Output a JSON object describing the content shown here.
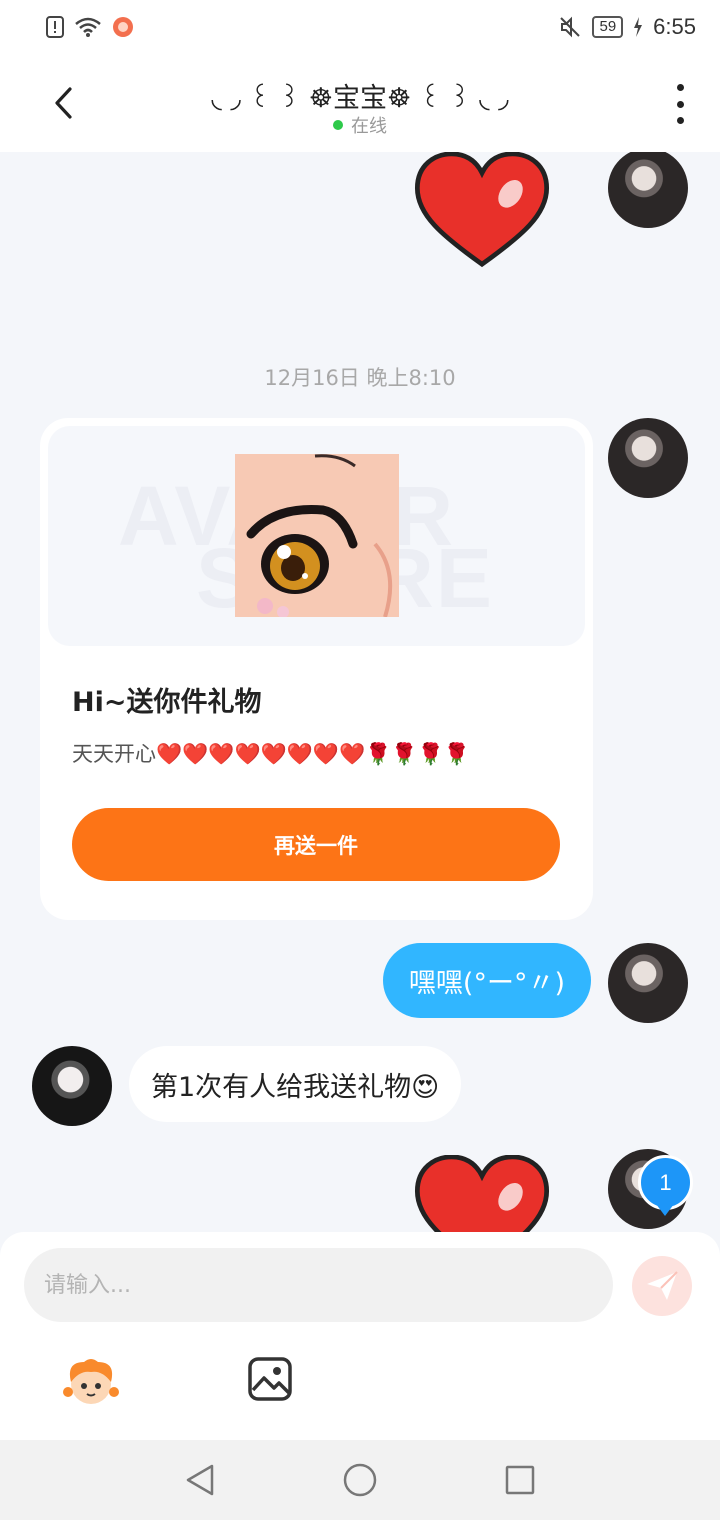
{
  "status_bar": {
    "time": "6:55",
    "battery": "59"
  },
  "header": {
    "title": "◟ ◞ ꒰ ꒱ ☸宝宝☸ ꒰ ꒱ ◟ ◞",
    "online_status": "在线"
  },
  "chat": {
    "timestamp": "12月16日 晚上8:10",
    "gift_card": {
      "watermark_top": "AVATAR",
      "watermark_bottom": "STORE",
      "title": "Hi~送你件礼物",
      "description": "天天开心❤️❤️❤️❤️❤️❤️❤️❤️🌹🌹🌹🌹",
      "button_label": "再送一件"
    },
    "messages": [
      {
        "from": "me",
        "text": "嘿嘿(°ー°〃)"
      },
      {
        "from": "other",
        "text": "第1次有人给我送礼物😍"
      }
    ],
    "unread_count": "1"
  },
  "input": {
    "placeholder": "请输入..."
  },
  "colors": {
    "accent_orange": "#fd7416",
    "bubble_blue": "#31b6ff",
    "badge_blue": "#1d96f8",
    "online_green": "#2ec94a"
  },
  "icons": {
    "back": "chevron-left-icon",
    "more": "more-vertical-icon",
    "send": "paper-plane-icon",
    "emoji": "mascot-emoji-icon",
    "image": "image-icon"
  }
}
